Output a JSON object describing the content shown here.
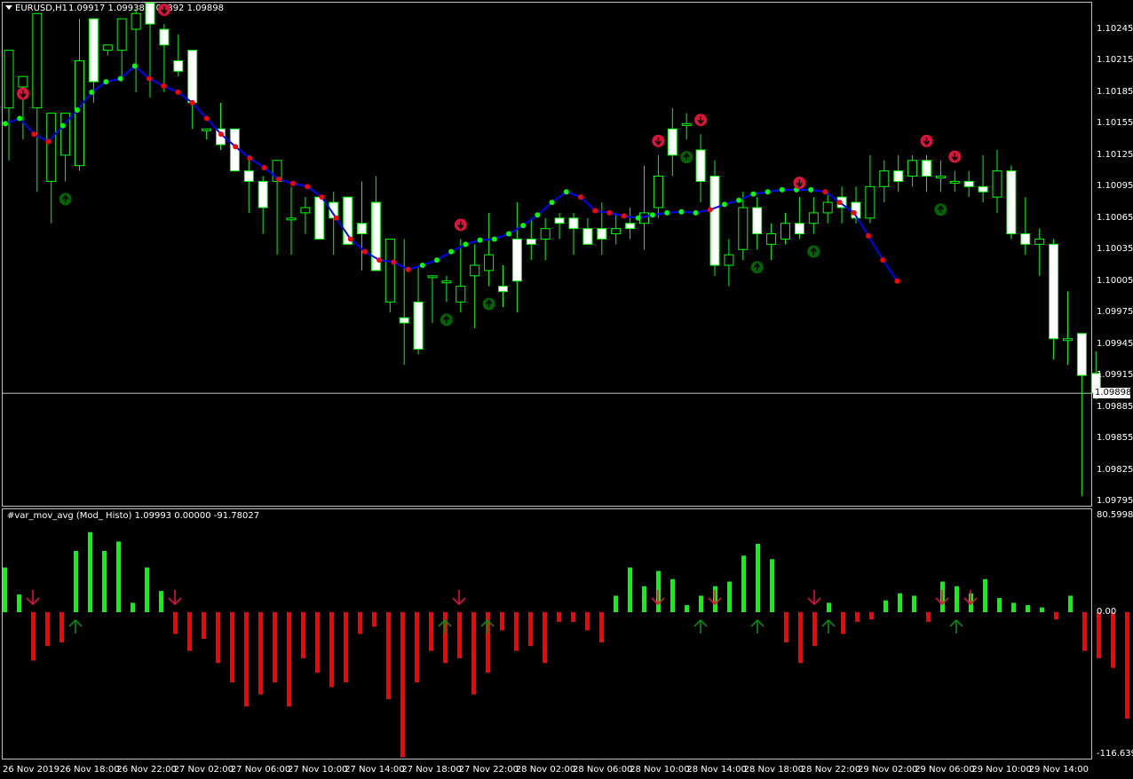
{
  "header": {
    "symbol": "EURUSD,H1",
    "ohlc": "1.09917 1.09938 1.09892 1.09898"
  },
  "indicator_header": "#var_mov_avg  (Mod_ Histo) 1.09993 0.00000 -91.78027",
  "current_price": "1.09898",
  "price_axis": [
    "1.10245",
    "1.10215",
    "1.10185",
    "1.10155",
    "1.10125",
    "1.10095",
    "1.10065",
    "1.10035",
    "1.10005",
    "1.09975",
    "1.09945",
    "1.09915",
    "1.09885",
    "1.09855",
    "1.09825",
    "1.09795"
  ],
  "indicator_axis": {
    "max": "80.59983",
    "zero": "0.00",
    "min": "-116.6394"
  },
  "time_axis": [
    "26 Nov 2019",
    "26 Nov 18:00",
    "26 Nov 22:00",
    "27 Nov 02:00",
    "27 Nov 06:00",
    "27 Nov 10:00",
    "27 Nov 14:00",
    "27 Nov 18:00",
    "27 Nov 22:00",
    "28 Nov 02:00",
    "28 Nov 06:00",
    "28 Nov 10:00",
    "28 Nov 14:00",
    "28 Nov 18:00",
    "28 Nov 22:00",
    "29 Nov 02:00",
    "29 Nov 06:00",
    "29 Nov 10:00",
    "29 Nov 14:00"
  ],
  "colors": {
    "background": "#000000",
    "candle_outline": "#00ff00",
    "bull_body": "#000000",
    "bear_body": "#ffffff",
    "ma_line": "#0000ff",
    "ma_up_dot": "#00ff00",
    "ma_down_dot": "#ff0000",
    "histo_up": "#00ff00",
    "histo_down": "#ff0000",
    "sell_signal": "#dc143c",
    "buy_signal": "#006400"
  },
  "chart_data": [
    {
      "type": "candlestick",
      "symbol": "EURUSD",
      "timeframe": "H1",
      "ylim": [
        1.09785,
        1.10265
      ],
      "candles": [
        [
          1.1017,
          1.10225,
          1.1012,
          1.1015
        ],
        [
          1.1019,
          1.102,
          1.1014,
          1.1017
        ],
        [
          1.1017,
          1.1026,
          1.1009,
          1.1011
        ],
        [
          1.101,
          1.10165,
          1.1006,
          1.1011
        ],
        [
          1.10125,
          1.10165,
          1.101,
          1.10115
        ],
        [
          1.10115,
          1.10215,
          1.1011,
          1.10255
        ],
        [
          1.10255,
          1.10195,
          1.10175,
          1.1024
        ],
        [
          1.10225,
          1.1023,
          1.1022,
          1.10227
        ],
        [
          1.10225,
          1.10255,
          1.10195,
          1.1024
        ],
        [
          1.10245,
          1.1026,
          1.10185,
          1.10265
        ],
        [
          1.1027,
          1.1025,
          1.1018,
          1.10195
        ],
        [
          1.10245,
          1.1023,
          1.10185,
          1.1025
        ],
        [
          1.10215,
          1.10205,
          1.102,
          1.1024
        ],
        [
          1.10225,
          1.10175,
          1.1015,
          1.10215
        ],
        [
          1.1015,
          1.1015,
          1.1014,
          1.1015
        ],
        [
          1.1015,
          1.10135,
          1.1013,
          1.10175
        ],
        [
          1.1015,
          1.1011,
          1.10115,
          1.10135
        ],
        [
          1.1011,
          1.101,
          1.1007,
          1.10125
        ],
        [
          1.101,
          1.10075,
          1.1005,
          1.10105
        ],
        [
          1.101,
          1.1012,
          1.1003,
          1.10115
        ],
        [
          1.10065,
          1.10065,
          1.1003,
          1.10095
        ],
        [
          1.1007,
          1.10075,
          1.1005,
          1.10085
        ],
        [
          1.10085,
          1.10045,
          1.10065,
          1.1008
        ],
        [
          1.1008,
          1.10065,
          1.1003,
          1.1009
        ],
        [
          1.10085,
          1.1004,
          1.1004,
          1.10085
        ],
        [
          1.1006,
          1.1005,
          1.10015,
          1.101
        ],
        [
          1.1008,
          1.10015,
          1.1002,
          1.10105
        ],
        [
          1.09985,
          1.10045,
          1.09975,
          1.1
        ],
        [
          1.0997,
          1.09965,
          1.09925,
          1.10045
        ],
        [
          1.09985,
          1.0994,
          1.09935,
          1.1002
        ],
        [
          1.1001,
          1.1001,
          1.09965,
          1.1
        ],
        [
          1.10005,
          1.10005,
          1.09985,
          1.1001
        ],
        [
          1.09985,
          1.1,
          1.09975,
          1.10045
        ],
        [
          1.1001,
          1.1002,
          1.0996,
          1.1004
        ],
        [
          1.10015,
          1.1003,
          1.1,
          1.1007
        ],
        [
          1.1,
          1.09995,
          1.0998,
          1.1002
        ],
        [
          1.10045,
          1.10005,
          1.09975,
          1.1008
        ],
        [
          1.10045,
          1.1004,
          1.10025,
          1.10065
        ],
        [
          1.10045,
          1.10055,
          1.10025,
          1.10065
        ],
        [
          1.10065,
          1.1006,
          1.10045,
          1.1007
        ],
        [
          1.10065,
          1.10055,
          1.1003,
          1.1007
        ],
        [
          1.10055,
          1.1004,
          1.1004,
          1.10065
        ],
        [
          1.10055,
          1.10045,
          1.1003,
          1.1008
        ],
        [
          1.1005,
          1.10055,
          1.1004,
          1.1007
        ],
        [
          1.1006,
          1.10055,
          1.10045,
          1.10075
        ],
        [
          1.1006,
          1.1007,
          1.10035,
          1.10115
        ],
        [
          1.10075,
          1.10105,
          1.10065,
          1.10125
        ],
        [
          1.1015,
          1.10125,
          1.10105,
          1.1017
        ],
        [
          1.10155,
          1.10155,
          1.1014,
          1.10165
        ],
        [
          1.1013,
          1.101,
          1.1008,
          1.10145
        ],
        [
          1.10105,
          1.1002,
          1.1001,
          1.1012
        ],
        [
          1.1002,
          1.1003,
          1.1,
          1.10045
        ],
        [
          1.10035,
          1.10075,
          1.10025,
          1.1009
        ],
        [
          1.10075,
          1.1005,
          1.10035,
          1.10085
        ],
        [
          1.1004,
          1.1005,
          1.10025,
          1.1006
        ],
        [
          1.10045,
          1.1006,
          1.1004,
          1.1007
        ],
        [
          1.1006,
          1.1005,
          1.10045,
          1.10085
        ],
        [
          1.1006,
          1.1007,
          1.1005,
          1.10085
        ],
        [
          1.1007,
          1.1008,
          1.1006,
          1.1009
        ],
        [
          1.10085,
          1.10075,
          1.1006,
          1.10095
        ],
        [
          1.1008,
          1.10065,
          1.1006,
          1.10095
        ],
        [
          1.10065,
          1.10095,
          1.1006,
          1.10125
        ],
        [
          1.10095,
          1.1011,
          1.1008,
          1.1012
        ],
        [
          1.1011,
          1.101,
          1.1009,
          1.10125
        ],
        [
          1.10105,
          1.1012,
          1.10095,
          1.10125
        ],
        [
          1.1012,
          1.10105,
          1.1009,
          1.10125
        ],
        [
          1.10105,
          1.10105,
          1.1009,
          1.1012
        ],
        [
          1.101,
          1.101,
          1.1009,
          1.1011
        ],
        [
          1.101,
          1.10095,
          1.10085,
          1.1011
        ],
        [
          1.10095,
          1.1009,
          1.1008,
          1.10125
        ],
        [
          1.10085,
          1.1011,
          1.1007,
          1.1013
        ],
        [
          1.1011,
          1.1005,
          1.10045,
          1.10115
        ],
        [
          1.1005,
          1.1004,
          1.1003,
          1.10085
        ],
        [
          1.1004,
          1.10045,
          1.1001,
          1.10055
        ],
        [
          1.1004,
          1.0995,
          1.0993,
          1.10045
        ],
        [
          1.0995,
          1.0995,
          1.09925,
          1.09995
        ],
        [
          1.09955,
          1.09915,
          1.098,
          1.0995
        ],
        [
          1.09917,
          1.09898,
          1.09892,
          1.09938
        ]
      ],
      "ma_line": [
        1.10155,
        1.1016,
        1.10145,
        1.10138,
        1.10153,
        1.10168,
        1.10185,
        1.10195,
        1.10198,
        1.1021,
        1.10198,
        1.10191,
        1.10185,
        1.10175,
        1.1016,
        1.10145,
        1.10133,
        1.10122,
        1.10113,
        1.10102,
        1.10098,
        1.10095,
        1.10085,
        1.10065,
        1.10045,
        1.10033,
        1.10025,
        1.10023,
        1.10016,
        1.1002,
        1.10025,
        1.10033,
        1.1004,
        1.10044,
        1.10045,
        1.1005,
        1.10058,
        1.10068,
        1.1008,
        1.1009,
        1.10085,
        1.10072,
        1.1007,
        1.10067,
        1.10065,
        1.10068,
        1.1007,
        1.10071,
        1.1007,
        1.10073,
        1.10078,
        1.10082,
        1.10088,
        1.1009,
        1.10092,
        1.10092,
        1.10092,
        1.1009,
        1.1008,
        1.1007,
        1.10048,
        1.10025,
        1.10005
      ],
      "ma_colors": [
        "up",
        "up",
        "down",
        "down",
        "up",
        "up",
        "up",
        "up",
        "up",
        "up",
        "down",
        "down",
        "down",
        "down",
        "down",
        "down",
        "down",
        "down",
        "down",
        "down",
        "down",
        "down",
        "down",
        "down",
        "down",
        "down",
        "down",
        "down",
        "down",
        "up",
        "up",
        "up",
        "up",
        "up",
        "up",
        "up",
        "up",
        "up",
        "up",
        "up",
        "down",
        "down",
        "down",
        "down",
        "up",
        "up",
        "up",
        "up",
        "up",
        "down",
        "up",
        "up",
        "up",
        "up",
        "up",
        "up",
        "up",
        "down",
        "down",
        "down",
        "down",
        "down",
        "down"
      ],
      "sell_arrows_at": [
        1,
        11,
        32,
        46,
        49,
        56,
        65,
        67
      ],
      "buy_arrows_at": [
        4,
        31,
        34,
        48,
        53,
        57,
        66
      ]
    },
    {
      "type": "bar",
      "title": "#var_mov_avg  (Mod_ Histo)",
      "ylim": [
        -116.6394,
        80.59983
      ],
      "values": [
        38,
        15,
        -40,
        -28,
        -25,
        52,
        68,
        52,
        60,
        8,
        38,
        18,
        -18,
        -32,
        -22,
        -42,
        -58,
        -78,
        -68,
        -58,
        -78,
        -38,
        -50,
        -62,
        -58,
        -18,
        -12,
        -72,
        -120,
        -58,
        -32,
        -42,
        -38,
        -68,
        -50,
        -15,
        -32,
        -28,
        -42,
        -8,
        -8,
        -15,
        -25,
        14,
        38,
        22,
        35,
        28,
        6,
        14,
        22,
        26,
        48,
        58,
        45,
        -25,
        -42,
        -28,
        8,
        -18,
        -8,
        -6,
        10,
        16,
        14,
        -8,
        26,
        22,
        16,
        28,
        12,
        8,
        6,
        4,
        -6,
        14,
        -32,
        -38,
        -46,
        -88,
        -83,
        -75
      ],
      "colors": [
        "up",
        "up",
        "down",
        "down",
        "down",
        "up",
        "up",
        "up",
        "up",
        "up",
        "up",
        "up",
        "down",
        "down",
        "down",
        "down",
        "down",
        "down",
        "down",
        "down",
        "down",
        "down",
        "down",
        "down",
        "down",
        "down",
        "down",
        "down",
        "down",
        "down",
        "down",
        "down",
        "down",
        "down",
        "down",
        "down",
        "down",
        "down",
        "down",
        "down",
        "down",
        "down",
        "down",
        "up",
        "up",
        "up",
        "up",
        "up",
        "up",
        "up",
        "up",
        "up",
        "up",
        "up",
        "up",
        "down",
        "down",
        "down",
        "up",
        "down",
        "down",
        "down",
        "up",
        "up",
        "up",
        "down",
        "up",
        "up",
        "up",
        "up",
        "up",
        "up",
        "up",
        "up",
        "down",
        "up",
        "down",
        "down",
        "down",
        "down",
        "down",
        "down"
      ]
    }
  ]
}
